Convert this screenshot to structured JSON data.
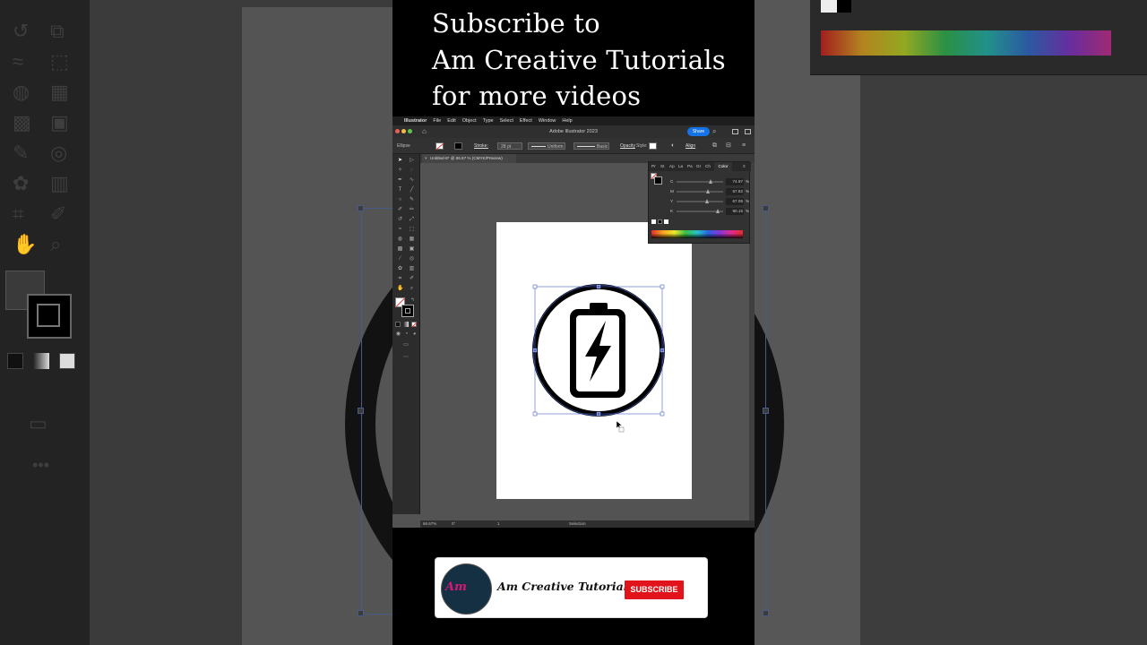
{
  "promo": {
    "line1": "Subscribe to",
    "line2": "Am Creative Tutorials",
    "line3": "for more videos"
  },
  "menubar": {
    "items": [
      "Illustrator",
      "File",
      "Edit",
      "Object",
      "Type",
      "Select",
      "Effect",
      "Window",
      "Help"
    ]
  },
  "titlebar": {
    "title": "Adobe Illustrator 2023",
    "share_label": "Share"
  },
  "controlbar": {
    "selection_type": "Ellipse",
    "stroke_label": "Stroke:",
    "stroke_weight": "28 pt",
    "profile_uniform": "Uniform",
    "profile_basic": "Basic",
    "opacity_label": "Opacity",
    "style_label": "Style:",
    "align_label": "Align"
  },
  "document": {
    "tab_label": "Untitled-8* @ 66.67 % (CMYK/Preview)"
  },
  "color_panel": {
    "tabs": [
      "Pr",
      "St",
      "Ap",
      "La",
      "Pa",
      "Gr",
      "Ch",
      "Color"
    ],
    "active_tab": "Color",
    "channels": [
      {
        "name": "C",
        "value": "74.97",
        "fraction": 0.7497
      },
      {
        "name": "M",
        "value": "67.92",
        "fraction": 0.6792
      },
      {
        "name": "Y",
        "value": "67.05",
        "fraction": 0.6705
      },
      {
        "name": "K",
        "value": "90.15",
        "fraction": 0.9015
      }
    ],
    "unit": "%"
  },
  "statusbar": {
    "zoom": "66.67%",
    "rotation": "0°",
    "artboard_number": "1",
    "tool": "Selection"
  },
  "banner": {
    "channel_name": "Am Creative Tutorials",
    "subscribe_label": "SUBSCRIBE",
    "logo_text": "Am"
  },
  "colors": {
    "accent_blue": "#1473e6",
    "subscribe_red": "#e1141b",
    "logo_pink": "#d6177a",
    "logo_bg": "#163043"
  },
  "icons": [
    "apple-icon",
    "home-icon",
    "search-icon",
    "close-icon",
    "selection-tool-icon",
    "battery-bolt-icon"
  ]
}
